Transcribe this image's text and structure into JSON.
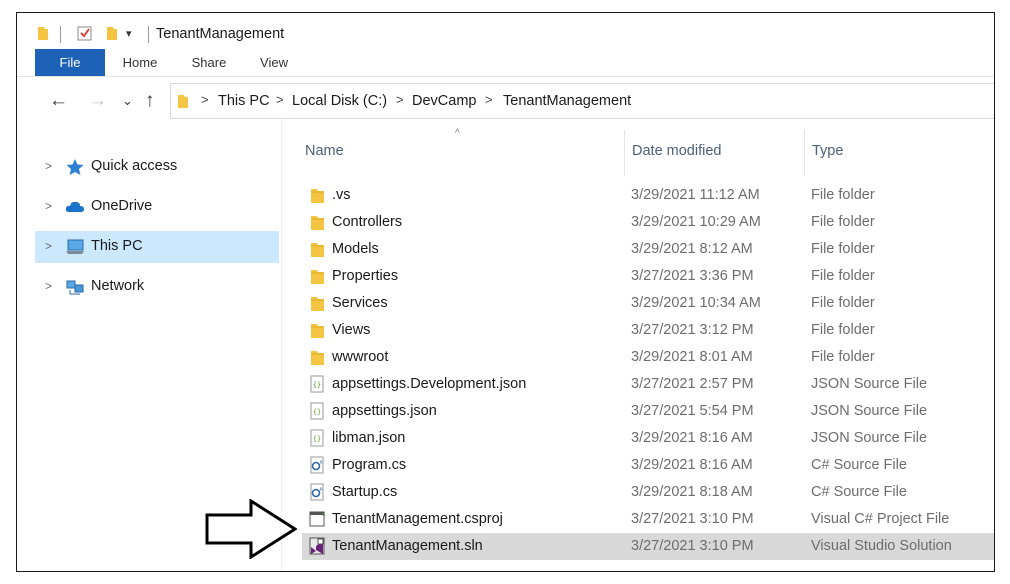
{
  "window": {
    "title": "TenantManagement"
  },
  "ribbon": {
    "tabs": [
      "File",
      "Home",
      "Share",
      "View"
    ]
  },
  "navigation": {
    "back_icon": "back-arrow-icon",
    "forward_icon": "forward-arrow-icon",
    "recent_icon": "chevron-down-icon",
    "up_icon": "up-arrow-icon",
    "breadcrumbs": [
      "This PC",
      "Local Disk (C:)",
      "DevCamp",
      "TenantManagement"
    ]
  },
  "sidebar": {
    "items": [
      {
        "label": "Quick access",
        "icon": "star-icon",
        "selected": false
      },
      {
        "label": "OneDrive",
        "icon": "cloud-icon",
        "selected": false
      },
      {
        "label": "This PC",
        "icon": "computer-icon",
        "selected": true
      },
      {
        "label": "Network",
        "icon": "network-icon",
        "selected": false
      }
    ]
  },
  "columns": {
    "name": "Name",
    "date": "Date modified",
    "type": "Type"
  },
  "files": [
    {
      "name": ".vs",
      "date": "3/29/2021 11:12 AM",
      "type": "File folder",
      "icon": "folder-icon"
    },
    {
      "name": "Controllers",
      "date": "3/29/2021 10:29 AM",
      "type": "File folder",
      "icon": "folder-icon"
    },
    {
      "name": "Models",
      "date": "3/29/2021 8:12 AM",
      "type": "File folder",
      "icon": "folder-icon"
    },
    {
      "name": "Properties",
      "date": "3/27/2021 3:36 PM",
      "type": "File folder",
      "icon": "folder-icon"
    },
    {
      "name": "Services",
      "date": "3/29/2021 10:34 AM",
      "type": "File folder",
      "icon": "folder-icon"
    },
    {
      "name": "Views",
      "date": "3/27/2021 3:12 PM",
      "type": "File folder",
      "icon": "folder-icon"
    },
    {
      "name": "wwwroot",
      "date": "3/29/2021 8:01 AM",
      "type": "File folder",
      "icon": "folder-icon"
    },
    {
      "name": "appsettings.Development.json",
      "date": "3/27/2021 2:57 PM",
      "type": "JSON Source File",
      "icon": "json-file-icon"
    },
    {
      "name": "appsettings.json",
      "date": "3/27/2021 5:54 PM",
      "type": "JSON Source File",
      "icon": "json-file-icon"
    },
    {
      "name": "libman.json",
      "date": "3/29/2021 8:16 AM",
      "type": "JSON Source File",
      "icon": "json-file-icon"
    },
    {
      "name": "Program.cs",
      "date": "3/29/2021 8:16 AM",
      "type": "C# Source File",
      "icon": "csharp-file-icon"
    },
    {
      "name": "Startup.cs",
      "date": "3/29/2021 8:18 AM",
      "type": "C# Source File",
      "icon": "csharp-file-icon"
    },
    {
      "name": "TenantManagement.csproj",
      "date": "3/27/2021 3:10 PM",
      "type": "Visual C# Project File",
      "icon": "csproj-file-icon"
    },
    {
      "name": "TenantManagement.sln",
      "date": "3/27/2021 3:10 PM",
      "type": "Visual Studio Solution",
      "icon": "sln-file-icon",
      "highlighted": true
    }
  ],
  "colors": {
    "file_tab": "#1d62b7",
    "selected_nav": "#cce8ff",
    "highlight_row": "#d9d9d9",
    "folder": "#f4c542",
    "header_text": "#4c607a"
  },
  "annotation": {
    "icon": "outline-arrow-right-icon"
  }
}
